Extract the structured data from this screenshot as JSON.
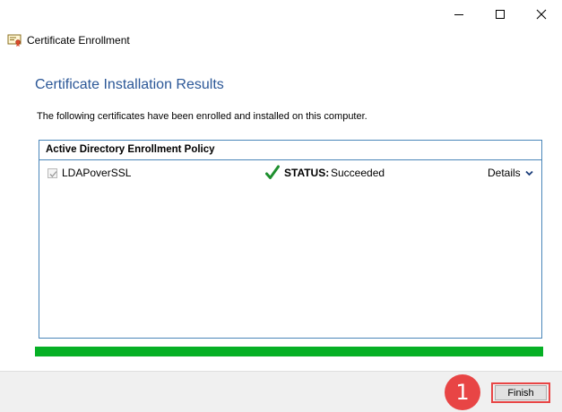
{
  "window": {
    "title": "Certificate Enrollment",
    "controls": {
      "minimize_icon": "minimize-icon",
      "maximize_icon": "maximize-icon",
      "close_icon": "close-icon"
    }
  },
  "page": {
    "title": "Certificate Installation Results",
    "description": "The following certificates have been enrolled and installed on this computer."
  },
  "results": {
    "policy_name": "Active Directory Enrollment Policy",
    "certificates": [
      {
        "name": "LDAPoverSSL",
        "checked": true,
        "status_label": "STATUS:",
        "status_value": "Succeeded",
        "details_label": "Details"
      }
    ]
  },
  "progress": {
    "percent": 100,
    "color": "#06b025"
  },
  "footer": {
    "step_number": "1",
    "finish_label": "Finish"
  },
  "colors": {
    "accent_title": "#2b5797",
    "box_border": "#4a86b9",
    "highlight": "#e84545",
    "success_green": "#1e8f2e"
  }
}
